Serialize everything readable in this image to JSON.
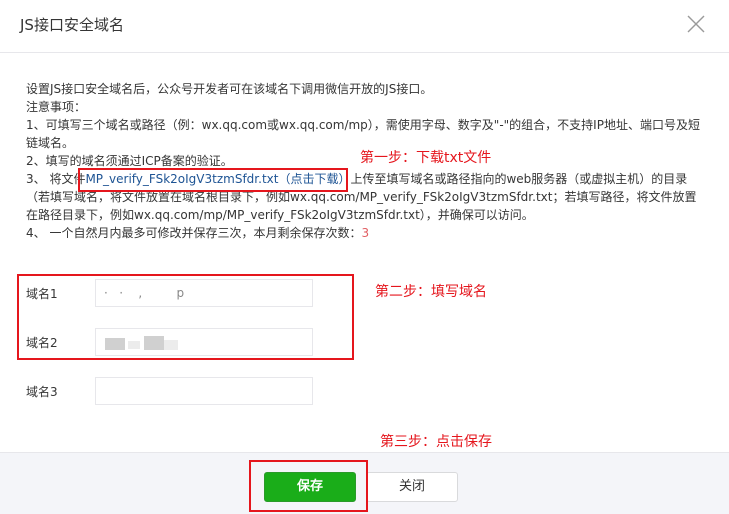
{
  "dialog": {
    "title": "JS接口安全域名"
  },
  "notice": {
    "line1": "设置JS接口安全域名后，公众号开发者可在该域名下调用微信开放的JS接口。",
    "line2": "注意事项：",
    "line3": "1、可填写三个域名或路径（例：wx.qq.com或wx.qq.com/mp），需使用字母、数字及\"-\"的组合，不支持IP地址、端口号及短链域名。",
    "line4": "2、填写的域名须通过ICP备案的验证。",
    "line5_prefix": "3、 将文件",
    "line5_link": "MP_verify_FSk2oIgV3tzmSfdr.txt（点击下载）",
    "line5_suffix": "上传至填写域名或路径指向的web服务器（或虚拟主机）的目录（若填写域名，将文件放置在域名根目录下，例如wx.qq.com/MP_verify_FSk2oIgV3tzmSfdr.txt；若填写路径，将文件放置在路径目录下，例如wx.qq.com/mp/MP_verify_FSk2oIgV3tzmSfdr.txt），并确保可以访问。",
    "line6_prefix": "4、 一个自然月内最多可修改并保存三次，本月剩余保存次数：",
    "line6_count": "3"
  },
  "annotations": {
    "step1": "第一步：下载txt文件",
    "step2": "第二步：填写域名",
    "step3": "第三步：点击保存"
  },
  "form": {
    "domain1_label": "域名1",
    "domain1_value": "·   ·    ,         p",
    "domain2_label": "域名2",
    "domain2_value": "",
    "domain3_label": "域名3",
    "domain3_value": ""
  },
  "footer": {
    "save_label": "保存",
    "close_label": "关闭"
  },
  "colors": {
    "accent_green": "#1aad19",
    "annotation_red": "#e5161d",
    "link_blue": "#1e5494",
    "count_red": "#e15f63"
  }
}
